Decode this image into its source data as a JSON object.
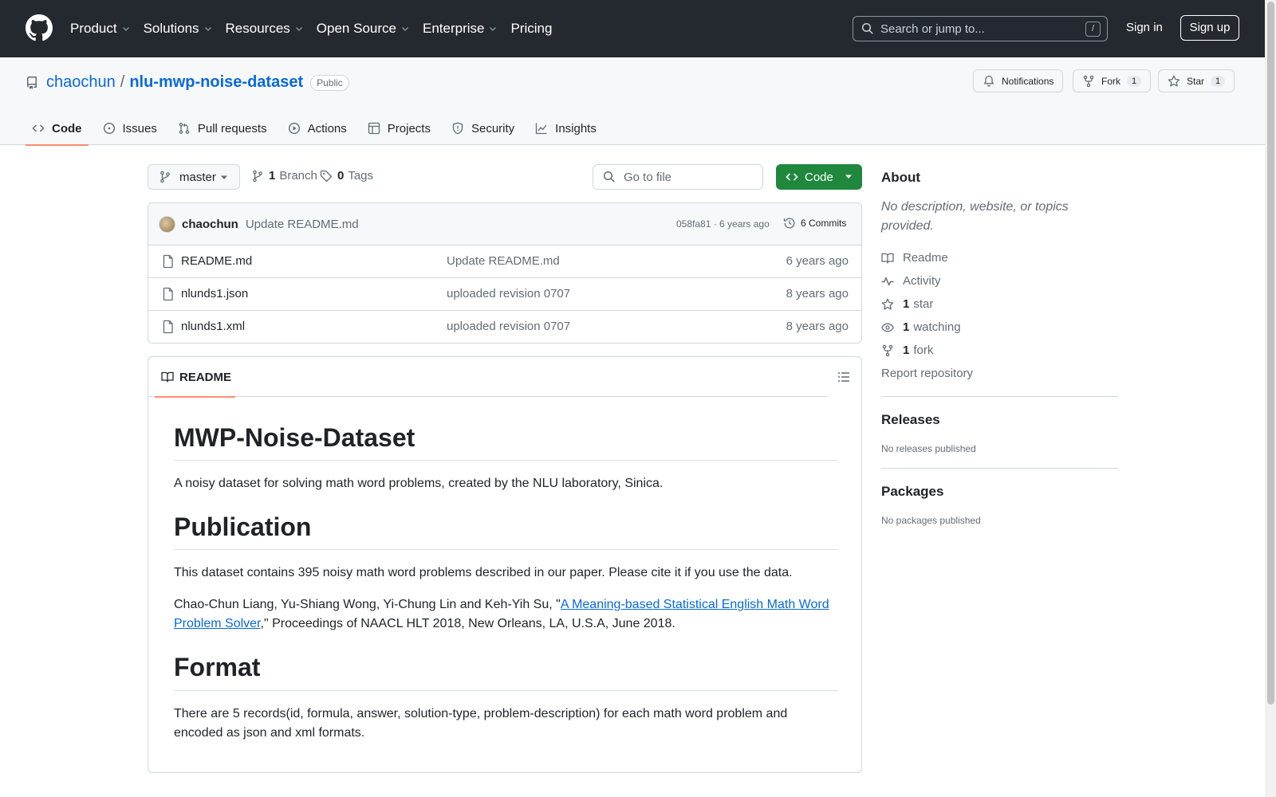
{
  "header": {
    "nav": [
      {
        "label": "Product",
        "chevron": true
      },
      {
        "label": "Solutions",
        "chevron": true
      },
      {
        "label": "Resources",
        "chevron": true
      },
      {
        "label": "Open Source",
        "chevron": true
      },
      {
        "label": "Enterprise",
        "chevron": true
      },
      {
        "label": "Pricing",
        "chevron": false
      }
    ],
    "search_placeholder": "Search or jump to...",
    "search_shortcut": "/",
    "sign_in": "Sign in",
    "sign_up": "Sign up"
  },
  "repo": {
    "owner": "chaochun",
    "separator": "/",
    "name": "nlu-mwp-noise-dataset",
    "visibility": "Public",
    "notifications_label": "Notifications",
    "fork_label": "Fork",
    "fork_count": "1",
    "star_label": "Star",
    "star_count": "1",
    "tabs": [
      "Code",
      "Issues",
      "Pull requests",
      "Actions",
      "Projects",
      "Security",
      "Insights"
    ]
  },
  "file_nav": {
    "branch": "master",
    "branch_count": "1",
    "branch_label": "Branch",
    "tag_count": "0",
    "tag_label": "Tags",
    "goto_placeholder": "Go to file",
    "code_button": "Code"
  },
  "latest_commit": {
    "author": "chaochun",
    "message": "Update README.md",
    "meta": "058fa81 · 6 years ago",
    "commits_label": "6 Commits"
  },
  "files": [
    {
      "name": "README.md",
      "message": "Update README.md",
      "age": "6 years ago"
    },
    {
      "name": "nlunds1.json",
      "message": "uploaded revision 0707",
      "age": "8 years ago"
    },
    {
      "name": "nlunds1.xml",
      "message": "uploaded revision 0707",
      "age": "8 years ago"
    }
  ],
  "readme": {
    "tab_label": "README",
    "h1": "MWP-Noise-Dataset",
    "intro": "A noisy dataset for solving math word problems, created by the NLU laboratory, Sinica.",
    "h2": "Publication",
    "pub_text": "This dataset contains 395 noisy math word problems described in our paper. Please cite it if you use the data.",
    "citation_prefix": "Chao-Chun Liang, Yu-Shiang Wong, Yi-Chung Lin and Keh-Yih Su, \"",
    "citation_link": "A Meaning-based Statistical English Math Word Problem Solver",
    "citation_suffix": ",\" Proceedings of NAACL HLT 2018, New Orleans, LA, U.S.A, June 2018.",
    "h3": "Format",
    "format_text": "There are 5 records(id, formula, answer, solution-type, problem-description) for each math word problem and encoded as json and xml formats."
  },
  "sidebar": {
    "about_title": "About",
    "about_desc": "No description, website, or topics provided.",
    "readme": "Readme",
    "activity": "Activity",
    "stars_count": "1",
    "stars_label": "star",
    "watching_count": "1",
    "watching_label": "watching",
    "forks_count": "1",
    "forks_label": "fork",
    "report": "Report repository",
    "releases_title": "Releases",
    "releases_empty": "No releases published",
    "packages_title": "Packages",
    "packages_empty": "No packages published"
  },
  "colors": {
    "header_bg": "#24292f",
    "link": "#0969da",
    "primary_button": "#1f883d",
    "tab_underline": "#fd8c73"
  }
}
